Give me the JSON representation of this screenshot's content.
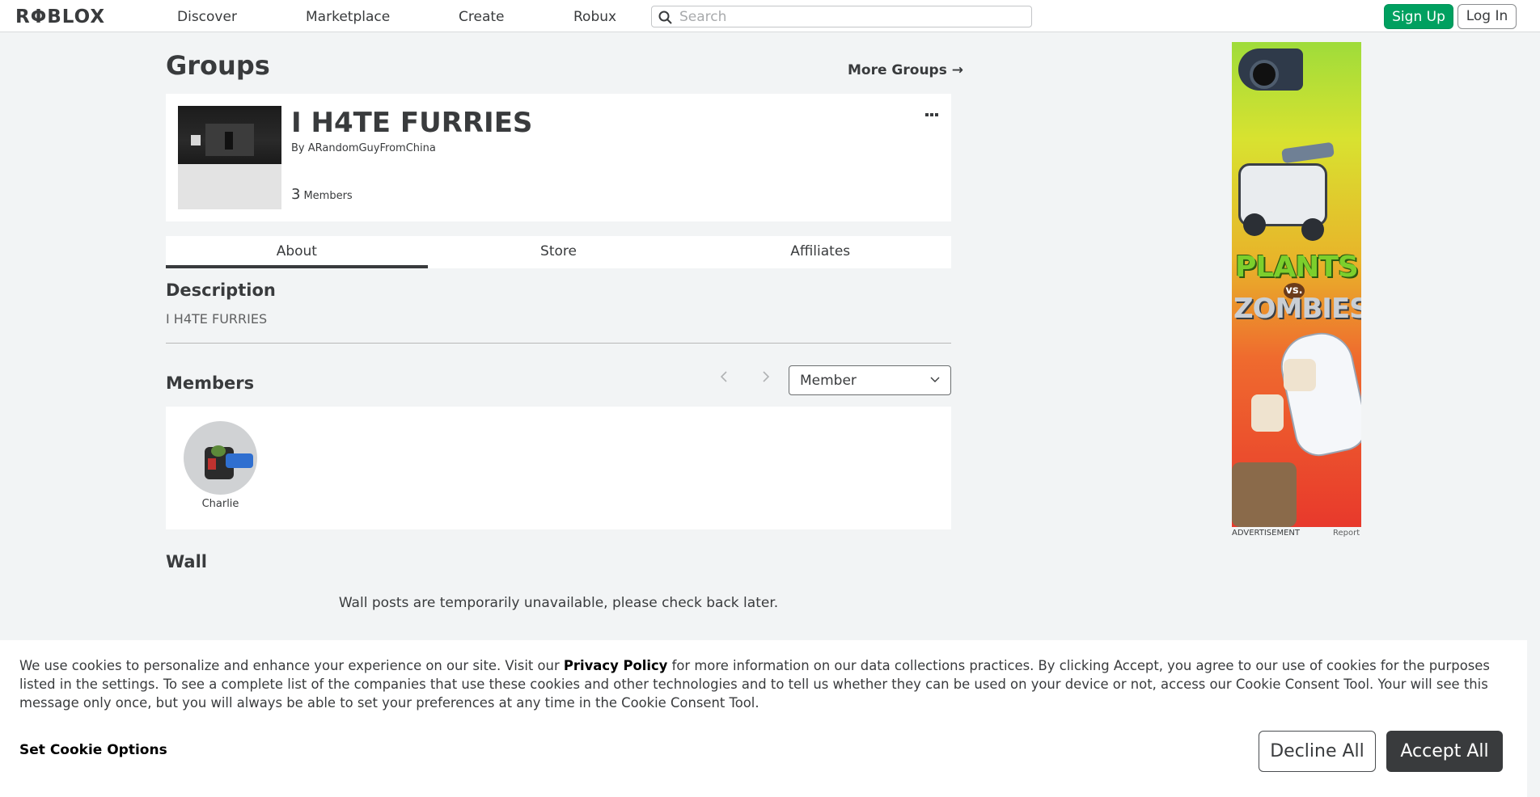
{
  "topbar": {
    "logo": "RΦBLOX",
    "nav": [
      "Discover",
      "Marketplace",
      "Create",
      "Robux"
    ],
    "search_placeholder": "Search",
    "signup_label": "Sign Up",
    "login_label": "Log In"
  },
  "page": {
    "title": "Groups",
    "more_groups": "More Groups →"
  },
  "group": {
    "name": "I H4TE FURRIES",
    "owner_prefix": "By",
    "owner": "ARandomGuyFromChina",
    "member_count": "3",
    "member_label": "Members",
    "menu_icon": "more-dots-icon"
  },
  "tabs": [
    {
      "label": "About",
      "active": true
    },
    {
      "label": "Store",
      "active": false
    },
    {
      "label": "Affiliates",
      "active": false
    }
  ],
  "description": {
    "title": "Description",
    "text": "I H4TE FURRIES"
  },
  "members": {
    "title": "Members",
    "prev_icon": "chevron-left-icon",
    "next_icon": "chevron-right-icon",
    "role_selected": "Member",
    "list": [
      {
        "name": "Charlie"
      }
    ]
  },
  "wall": {
    "title": "Wall",
    "message": "Wall posts are temporarily unavailable, please check back later."
  },
  "ad": {
    "label": "ADVERTISEMENT",
    "report": "Report",
    "brand_top": "PLANTS",
    "brand_vs": "vs.",
    "brand_bottom": "ZOMBIES"
  },
  "cookie": {
    "text_pre": "We use cookies to personalize and enhance your experience on our site. Visit our ",
    "policy_link": "Privacy Policy",
    "text_post": " for more information on our data collections practices. By clicking Accept, you agree to our use of cookies for the purposes listed in the settings. To see a complete list of the companies that use these cookies and other technologies and to tell us whether they can be used on your device or not, access our Cookie Consent Tool. Your will see this message only once, but you will always be able to set your preferences at any time in the Cookie Consent Tool.",
    "options_label": "Set Cookie Options",
    "decline_label": "Decline All",
    "accept_label": "Accept All"
  },
  "colors": {
    "signup_green": "#00a060",
    "text_dark": "#393b3d",
    "background": "#f2f4f5"
  }
}
